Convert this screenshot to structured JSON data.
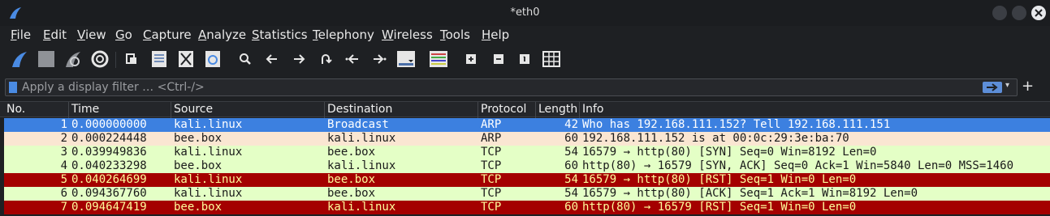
{
  "window": {
    "title": "*eth0"
  },
  "menu": [
    "File",
    "Edit",
    "View",
    "Go",
    "Capture",
    "Analyze",
    "Statistics",
    "Telephony",
    "Wireless",
    "Tools",
    "Help"
  ],
  "menu_mnemonic_index": [
    0,
    0,
    0,
    0,
    0,
    0,
    0,
    0,
    0,
    0,
    0
  ],
  "toolbar": {
    "icons": [
      "shark-fin-start-icon",
      "stop-square-icon",
      "restart-fin-icon",
      "options-gear-icon",
      "open-file-icon",
      "save-file-icon",
      "close-file-icon",
      "reload-file-icon",
      "find-packet-icon",
      "go-back-icon",
      "go-forward-icon",
      "go-to-packet-icon",
      "first-packet-icon",
      "last-packet-icon",
      "autoscroll-icon",
      "colorize-icon",
      "zoom-in-icon",
      "zoom-out-icon",
      "normal-size-icon",
      "resize-columns-icon"
    ]
  },
  "filter": {
    "placeholder": "Apply a display filter … <Ctrl-/>"
  },
  "columns": [
    "No.",
    "Time",
    "Source",
    "Destination",
    "Protocol",
    "Length",
    "Info"
  ],
  "packets": [
    {
      "no": "1",
      "time": "0.000000000",
      "source": "kali.linux",
      "destination": "Broadcast",
      "protocol": "ARP",
      "length": "42",
      "info": "Who has 192.168.111.152? Tell 192.168.111.151",
      "style": "selected"
    },
    {
      "no": "2",
      "time": "0.000224448",
      "source": "bee.box",
      "destination": "kali.linux",
      "protocol": "ARP",
      "length": "60",
      "info": "192.168.111.152 is at 00:0c:29:3e:ba:70",
      "style": "arp"
    },
    {
      "no": "3",
      "time": "0.039949836",
      "source": "kali.linux",
      "destination": "bee.box",
      "protocol": "TCP",
      "length": "54",
      "info": "16579 → http(80) [SYN] Seq=0 Win=8192 Len=0",
      "style": "tcp"
    },
    {
      "no": "4",
      "time": "0.040233298",
      "source": "bee.box",
      "destination": "kali.linux",
      "protocol": "TCP",
      "length": "60",
      "info": "http(80) → 16579 [SYN, ACK] Seq=0 Ack=1 Win=5840 Len=0 MSS=1460",
      "style": "tcp"
    },
    {
      "no": "5",
      "time": "0.040264699",
      "source": "kali.linux",
      "destination": "bee.box",
      "protocol": "TCP",
      "length": "54",
      "info": "16579 → http(80) [RST] Seq=1 Win=0 Len=0",
      "style": "rst"
    },
    {
      "no": "6",
      "time": "0.094367760",
      "source": "kali.linux",
      "destination": "bee.box",
      "protocol": "TCP",
      "length": "54",
      "info": "16579 → http(80) [ACK] Seq=1 Ack=1 Win=8192 Len=0",
      "style": "tcp"
    },
    {
      "no": "7",
      "time": "0.094647419",
      "source": "bee.box",
      "destination": "kali.linux",
      "protocol": "TCP",
      "length": "60",
      "info": "http(80) → 16579 [RST] Seq=1 Win=0 Len=0",
      "style": "rst"
    }
  ],
  "colors": {
    "selected": "#3c80e0",
    "arp": "#fae6d2",
    "tcp": "#e4ffc6",
    "rst": "#a40000",
    "rst_text": "#fffc9c"
  }
}
